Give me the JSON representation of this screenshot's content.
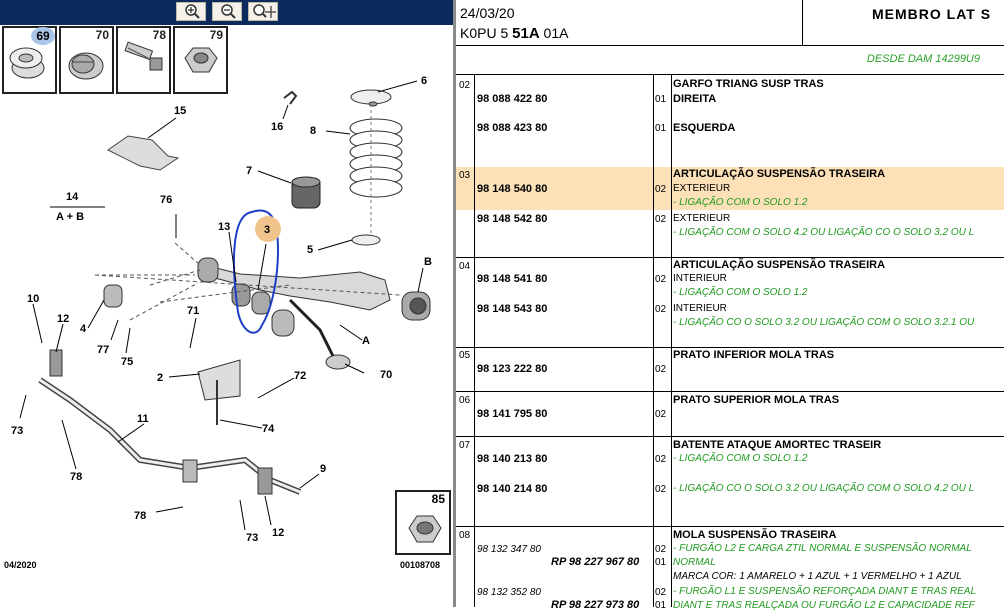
{
  "toolbar": {
    "buttons": [
      {
        "name": "zoom-in-icon"
      },
      {
        "name": "zoom-out-icon"
      },
      {
        "name": "zoom-fit-icon"
      }
    ]
  },
  "thumbnails": [
    {
      "num": "69"
    },
    {
      "num": "70"
    },
    {
      "num": "78"
    },
    {
      "num": "79"
    }
  ],
  "diagram": {
    "labels": {
      "l6": "6",
      "l8": "8",
      "l15": "15",
      "l16": "16",
      "l7": "7",
      "l14": "14",
      "lAB": "A + B",
      "l76": "76",
      "l13": "13",
      "l3": "3",
      "l5": "5",
      "lB": "B",
      "l10": "10",
      "l12": "12",
      "l4": "4",
      "l77": "77",
      "l75": "75",
      "l71": "71",
      "lA": "A",
      "l70": "70",
      "l2": "2",
      "l72": "72",
      "l74": "74",
      "l73": "73",
      "l11": "11",
      "l78": "78",
      "l9": "9",
      "l78b": "78",
      "l73b": "73",
      "l12b": "12"
    },
    "box85_num": "85",
    "footer_left": "04/2020",
    "footer_right": "00108708"
  },
  "header": {
    "date": "24/03/20",
    "code_prefix": "K0PU 5 ",
    "code_bold": "51A",
    "code_suffix": " 01A",
    "title": "MEMBRO LAT S",
    "desde": "DESDE DAM 14299U9"
  },
  "rows": [
    {
      "group": "02",
      "desc": "GARFO TRIANG SUSP TRAS",
      "refs": [
        {
          "ref": "98 088 422 80",
          "qty": "01",
          "text": "DIREITA"
        },
        {
          "ref": "98 088 423 80",
          "qty": "01",
          "text": "ESQUERDA"
        }
      ]
    },
    {
      "group": "03",
      "desc": "ARTICULAÇÃO SUSPENSÃO TRASEIRA",
      "refs": [
        {
          "ref": "98 148 540 80",
          "qty": "02",
          "sub": "EXTERIEUR",
          "green": "- LIGAÇÃO COM O SOLO 1.2"
        },
        {
          "ref": "98 148 542 80",
          "qty": "02",
          "sub": "EXTERIEUR",
          "green": "- LIGAÇÃO COM O SOLO 4.2 OU LIGAÇÃO CO O SOLO 3.2 OU L"
        }
      ]
    },
    {
      "group": "04",
      "desc": "ARTICULAÇÃO SUSPENSÃO TRASEIRA",
      "refs": [
        {
          "ref": "98 148 541 80",
          "qty": "02",
          "sub": "INTERIEUR",
          "green": "- LIGAÇÃO COM O SOLO 1.2"
        },
        {
          "ref": "98 148 543 80",
          "qty": "02",
          "sub": "INTERIEUR",
          "green": "- LIGAÇÃO CO O SOLO 3.2 OU LIGAÇÃO COM O SOLO 3.2.1 OU"
        }
      ]
    },
    {
      "group": "05",
      "desc": "PRATO INFERIOR MOLA TRAS",
      "refs": [
        {
          "ref": "98 123 222 80",
          "qty": "02"
        }
      ]
    },
    {
      "group": "06",
      "desc": "PRATO SUPERIOR MOLA TRAS",
      "refs": [
        {
          "ref": "98 141 795 80",
          "qty": "02"
        }
      ]
    },
    {
      "group": "07",
      "desc": "BATENTE ATAQUE AMORTEC TRASEIR",
      "refs": [
        {
          "ref": "98 140 213 80",
          "qty": "02",
          "green": "- LIGAÇÃO COM O SOLO 1.2"
        },
        {
          "ref": "98 140 214 80",
          "qty": "02",
          "green": "- LIGAÇÃO CO O SOLO 3.2 OU LIGAÇÃO COM O SOLO 4.2 OU L"
        }
      ]
    },
    {
      "group": "08",
      "desc": "MOLA SUSPENSÃO TRASEIRA",
      "refs": [
        {
          "ref": "98 132 347 80",
          "qty": "02",
          "green": "- FURGÃO L2 E CARGA ZTIL NORMAL E SUSPENSÃO NORMAL"
        },
        {
          "rp": "RP 98 227 967 80",
          "qty": "01",
          "green": "NORMAL"
        },
        {
          "sub": "MARCA COR: 1 AMARELO + 1 AZUL + 1 VERMELHO + 1 AZUL"
        },
        {
          "ref": "98 132 352 80",
          "qty": "02",
          "green": "- FURGÃO L1 E SUSPENSÃO REFORÇADA DIANT E TRAS REAL"
        },
        {
          "rp": "RP 98 227 973 80",
          "qty": "01",
          "green": "DIANT E TRAS REALÇADA OU FURGÃO L2 E CAPACIDADE REF"
        }
      ]
    }
  ]
}
